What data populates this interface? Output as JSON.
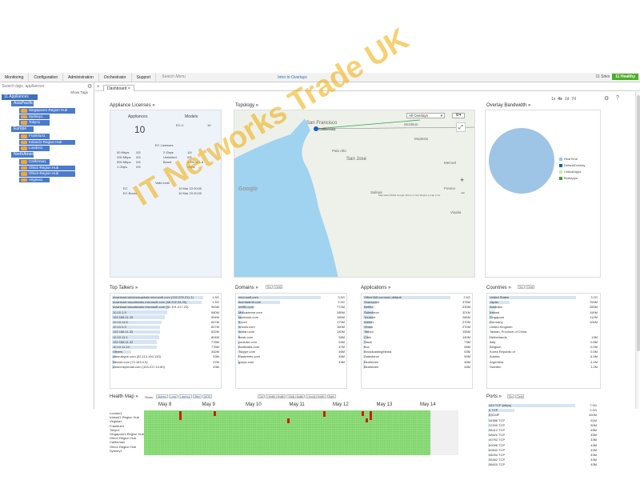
{
  "nav": {
    "items": [
      "Monitoring",
      "Configuration",
      "Administration",
      "Orchestrator",
      "Support"
    ],
    "search_placeholder": "Search Menu",
    "intro": "Intro to Overlays",
    "sites_info": "11 Sites",
    "health_badge": "11 Healthy"
  },
  "sidebar": {
    "search_placeholder": "Search tags, appliances",
    "show_tags": "Show Tags",
    "root": "11 Appliances",
    "groups": [
      {
        "name": "AsiaPacific",
        "leaves": [
          "Singapore1-Region Hub",
          "Sydney1",
          "Tokyo1"
        ]
      },
      {
        "name": "Europe",
        "leaves": [
          "Frankfurt1",
          "Ireland1-Region Hub",
          "London1"
        ]
      },
      {
        "name": "NorthAmerica",
        "leaves": [
          "California1",
          "Ohio1-Region Hub",
          "Ohio2-Region Hub",
          "Virginia1"
        ]
      }
    ]
  },
  "tabs": {
    "dashboard": "Dashboard"
  },
  "zoom": [
    "1x",
    "4x",
    "1d",
    "7d"
  ],
  "appliance_licenses": {
    "title": "Appliance Licenses »",
    "appliances_label": "Appliances",
    "appliances_count": "10",
    "models_label": "Models",
    "model_name": "EC-V",
    "model_count": "10",
    "ec_licenses": "EC Licenses",
    "rows_left": [
      [
        "50 Mbps",
        "2/5"
      ],
      [
        "200 Mbps",
        "2/5"
      ],
      [
        "500 Mbps",
        "2/5"
      ],
      [
        "1 Gbps",
        "2/5"
      ]
    ],
    "rows_mid": [
      [
        "2 Gbps",
        "1/5"
      ],
      [
        "Unlimited",
        "2/5"
      ],
      [
        "Boost",
        "4.4% of 1.6"
      ],
      [
        "",
        "Gbps"
      ]
    ],
    "valid_until": "Valid Until",
    "ec": "EC",
    "ec_date": "10 Mar 23 00:00",
    "ec_boost": "EC Boost",
    "ec_boost_date": "10 Mar 23 00:00"
  },
  "topology": {
    "title": "Topology »",
    "overlay_select": "All Overlays",
    "map_labels": [
      "San Francisco",
      "California1",
      "San Jose",
      "Palo Alto",
      "Modesto",
      "Stockton",
      "Merced",
      "Salinas",
      "Fresno",
      "Visalia"
    ],
    "attribution": "Map data ©2022 Google   Terms of Use   Report a map error",
    "zoom_in": "+",
    "zoom_out": "−"
  },
  "overlay_bandwidth": {
    "title": "Overlay Bandwidth »",
    "legend": [
      "RealTime",
      "DefaultOverlay",
      "CriticalApps",
      "BulkApps"
    ],
    "legend_colors": [
      "#9ec5e6",
      "#1f5f8b",
      "#cbe8a6",
      "#4a9b2e"
    ],
    "slice_label": "99.9%"
  },
  "top_talkers": {
    "title": "Top Talkers »",
    "rows": [
      {
        "label": "download.windowsupdate.microsoft.com (192.229.211.1)",
        "value": "1.5G",
        "frac": 0.99
      },
      {
        "label": "download.visualstudio.microsoft.com (68.232.34.20)",
        "value": "1.5G",
        "frac": 0.97
      },
      {
        "label": "download.visualstudio.microsoft.com (52.191.217.23)",
        "value": "963M",
        "frac": 0.62
      },
      {
        "label": "10.10.1.5",
        "value": "960M",
        "frac": 0.6
      },
      {
        "label": "192.168.11.10",
        "value": "904M",
        "frac": 0.57
      },
      {
        "label": "10.10.11.5",
        "value": "847M",
        "frac": 0.54
      },
      {
        "label": "10.10.3.3",
        "value": "827M",
        "frac": 0.52
      },
      {
        "label": "192.168.11.33",
        "value": "822M",
        "frac": 0.52
      },
      {
        "label": "10.10.11.1",
        "value": "804M",
        "frac": 0.51
      },
      {
        "label": "192.168.11.22",
        "value": "778M",
        "frac": 0.49
      },
      {
        "label": "10.10.11.10",
        "value": "778M",
        "frac": 0.49
      },
      {
        "label": "Others",
        "value": "342M",
        "frac": 0.21
      },
      {
        "label": "www.skype.com (52.113.194.133)",
        "value": "53M",
        "frac": 0.04
      },
      {
        "label": "fallows.com (72.163.4.5)",
        "value": "47M",
        "frac": 0.03
      },
      {
        "label": "www.insprenatl.com (104.017.14.60)",
        "value": "43M",
        "frac": 0.03
      }
    ]
  },
  "domains": {
    "title": "Domains »",
    "filters": [
      "Src",
      "Dest"
    ],
    "rows": [
      {
        "label": "microsoft.com",
        "value": "3.5G",
        "frac": 0.99
      },
      {
        "label": "fluentadmit.com",
        "value": "2.0G",
        "frac": 0.5
      },
      {
        "label": "netflix.com",
        "value": "772M",
        "frac": 0.2
      },
      {
        "label": "Mercademe.com",
        "value": "285M",
        "frac": 0.08
      },
      {
        "label": "facebook.com",
        "value": "185M",
        "frac": 0.05
      },
      {
        "label": "ft.com",
        "value": "173M",
        "frac": 0.05
      },
      {
        "label": "hmoes.com",
        "value": "160M",
        "frac": 0.04
      },
      {
        "label": "linkfan.com",
        "value": "140M",
        "frac": 0.04
      },
      {
        "label": "flowb.com",
        "value": "98M",
        "frac": 0.03
      },
      {
        "label": "youtube.com",
        "value": "54M",
        "frac": 0.02
      },
      {
        "label": "flowbtalks.com",
        "value": "47M",
        "frac": 0.02
      },
      {
        "label": "Tskype.com",
        "value": "46M",
        "frac": 0.02
      },
      {
        "label": "Rasteeres.com",
        "value": "45M",
        "frac": 0.02
      },
      {
        "label": "gdvpc.com",
        "value": "43M",
        "frac": 0.02
      }
    ]
  },
  "applications": {
    "title": "Applications »",
    "rows": [
      {
        "label": "Office365.common,default",
        "value": "2.6G",
        "frac": 0.99
      },
      {
        "label": "Sharepoint",
        "value": "378M",
        "frac": 0.15
      },
      {
        "label": "Netflix",
        "value": "330M",
        "frac": 0.13
      },
      {
        "label": "Salesforce",
        "value": "321M",
        "frac": 0.12
      },
      {
        "label": "Youtube",
        "value": "285M",
        "frac": 0.11
      },
      {
        "label": "Webex",
        "value": "270M",
        "frac": 0.1
      },
      {
        "label": "Vimeo",
        "value": "270M",
        "frac": 0.1
      },
      {
        "label": "Tibbco",
        "value": "155M",
        "frac": 0.06
      },
      {
        "label": "Citrix",
        "value": "140M",
        "frac": 0.05
      },
      {
        "label": "Slack",
        "value": "73M",
        "frac": 0.03
      },
      {
        "label": "Box",
        "value": "56M",
        "frac": 0.02
      },
      {
        "label": "BroadcastingMedia",
        "value": "53M",
        "frac": 0.02
      },
      {
        "label": "Salesforce",
        "value": "50M",
        "frac": 0.02
      },
      {
        "label": "Bluebeam",
        "value": "46M",
        "frac": 0.02
      },
      {
        "label": "Bluebeam",
        "value": "45M",
        "frac": 0.02
      }
    ]
  },
  "countries": {
    "title": "Countries »",
    "filters": [
      "Src",
      "Dest"
    ],
    "rows": [
      {
        "label": "United States",
        "value": "3.2G",
        "frac": 0.99
      },
      {
        "label": "Japan",
        "value": "763M",
        "frac": 0.24
      },
      {
        "label": "Australia",
        "value": "263M",
        "frac": 0.08
      },
      {
        "label": "Ireland",
        "value": "190M",
        "frac": 0.06
      },
      {
        "label": "Singapore",
        "value": "112M",
        "frac": 0.04
      },
      {
        "label": "Germany",
        "value": "104M",
        "frac": 0.03
      },
      {
        "label": "United Kingdom",
        "value": "",
        "frac": 0.0
      },
      {
        "label": "Taiwan, Province of China",
        "value": "",
        "frac": 0.0
      },
      {
        "label": "Netherlands",
        "value": "13M",
        "frac": 0.01
      },
      {
        "label": "Italy",
        "value": "0.8M",
        "frac": 0.0
      },
      {
        "label": "Belgium",
        "value": "0.0M",
        "frac": 0.0
      },
      {
        "label": "Korea Republic of",
        "value": "0.0M",
        "frac": 0.0
      },
      {
        "label": "Austria",
        "value": "6.3M",
        "frac": 0.0
      },
      {
        "label": "Argentina",
        "value": "4.2M",
        "frac": 0.0
      },
      {
        "label": "Sweden",
        "value": "1.2M",
        "frac": 0.0
      }
    ]
  },
  "health_map": {
    "title": "Health Map »",
    "show_label": "Show",
    "show_filters": [
      "Alarms",
      "Loss",
      "Latency",
      "Jitter",
      "MOS"
    ],
    "view_filters": [
      "Ovl",
      "Health Health",
      "Daily Health",
      "Hourly Health",
      "Bate"
    ],
    "dates": [
      "May 8",
      "May 9",
      "May 10",
      "May 11",
      "May 12",
      "May 13",
      "May 14"
    ],
    "rows": [
      "London1",
      "Ireland1-Region Hub",
      "Virginia1",
      "Frankfurt1",
      "Tokyo1",
      "Singapore1-Region Hub",
      "Ohio2-Region Hub",
      "California1",
      "Ohio1-Region Hub",
      "Sydney1"
    ]
  },
  "ports": {
    "title": "Ports »",
    "filters": [
      "Src",
      "Dest"
    ],
    "rows": [
      {
        "label": "443 TCP (https)",
        "value": "7.0G",
        "frac": 0.99
      },
      {
        "label": "0 TCP",
        "value": "2.0G",
        "frac": 0.3
      },
      {
        "label": "0 ICMP",
        "value": "320M",
        "frac": 0.05
      },
      {
        "label": "34586 TCP",
        "value": "51M",
        "frac": 0.01
      },
      {
        "label": "22200 TCP",
        "value": "50M",
        "frac": 0.01
      },
      {
        "label": "58412 TCP",
        "value": "45M",
        "frac": 0.01
      },
      {
        "label": "58520 TCP",
        "value": "45M",
        "frac": 0.01
      },
      {
        "label": "40752 TCP",
        "value": "43M",
        "frac": 0.01
      },
      {
        "label": "60096 TCP",
        "value": "43M",
        "frac": 0.01
      },
      {
        "label": "60842 TCP",
        "value": "43M",
        "frac": 0.01
      },
      {
        "label": "58094 TCP",
        "value": "43M",
        "frac": 0.01
      },
      {
        "label": "55452 TCP",
        "value": "43M",
        "frac": 0.01
      },
      {
        "label": "58820 TCP",
        "value": "43M",
        "frac": 0.01
      }
    ]
  },
  "watermark": "IT Networks Trade UK"
}
